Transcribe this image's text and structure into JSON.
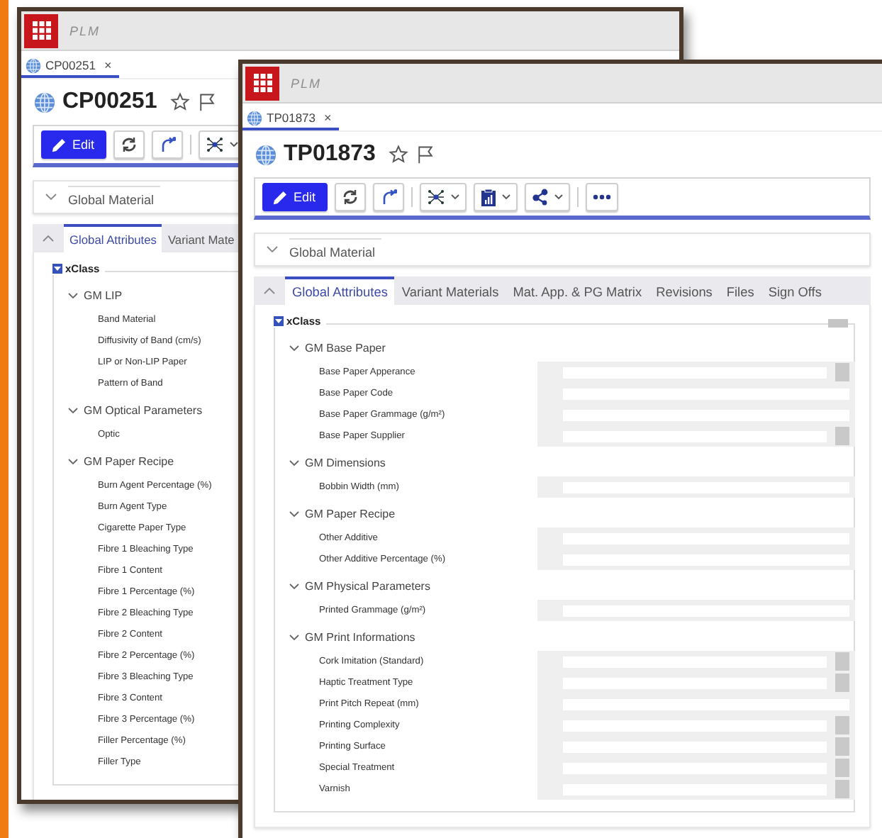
{
  "windows": [
    {
      "logo": "PLM",
      "doc_tab": {
        "label": "CP00251",
        "close": "×",
        "selected": true
      },
      "title": "CP00251",
      "toolbar": [
        {
          "kind": "edit",
          "label": "Edit"
        },
        {
          "kind": "refresh"
        },
        {
          "kind": "redo"
        },
        {
          "kind": "separator"
        },
        {
          "kind": "network",
          "menu": true
        }
      ],
      "section": {
        "label": "Global Material",
        "expanded": false
      },
      "tabs_expanded": true,
      "tabs": [
        {
          "label": "Global Attributes",
          "selected": true
        },
        {
          "label": "Variant Mate",
          "selected": false
        }
      ],
      "panel": {
        "title": "xClass",
        "groups": [
          {
            "name": "GM LIP",
            "expanded": true,
            "attributes": [
              {
                "label": "Band Material"
              },
              {
                "label": "Diffusivity of Band (cm/s)"
              },
              {
                "label": "LIP or Non-LIP Paper"
              },
              {
                "label": "Pattern of Band"
              }
            ]
          },
          {
            "name": "GM Optical Parameters",
            "expanded": true,
            "attributes": [
              {
                "label": "Optic"
              }
            ]
          },
          {
            "name": "GM Paper Recipe",
            "expanded": true,
            "attributes": [
              {
                "label": "Burn Agent Percentage (%)"
              },
              {
                "label": "Burn Agent Type"
              },
              {
                "label": "Cigarette Paper Type"
              },
              {
                "label": "Fibre 1 Bleaching Type"
              },
              {
                "label": "Fibre 1 Content"
              },
              {
                "label": "Fibre 1 Percentage (%)"
              },
              {
                "label": "Fibre 2 Bleaching Type"
              },
              {
                "label": "Fibre 2 Content"
              },
              {
                "label": "Fibre 2 Percentage (%)"
              },
              {
                "label": "Fibre 3 Bleaching Type"
              },
              {
                "label": "Fibre 3 Content"
              },
              {
                "label": "Fibre 3 Percentage (%)"
              },
              {
                "label": "Filler Percentage (%)"
              },
              {
                "label": "Filler Type"
              }
            ]
          }
        ]
      }
    },
    {
      "logo": "PLM",
      "doc_tab": {
        "label": "TP01873",
        "close": "×",
        "selected": true
      },
      "title": "TP01873",
      "toolbar": [
        {
          "kind": "edit",
          "label": "Edit"
        },
        {
          "kind": "refresh"
        },
        {
          "kind": "redo"
        },
        {
          "kind": "separator"
        },
        {
          "kind": "network",
          "menu": true
        },
        {
          "kind": "report",
          "menu": true
        },
        {
          "kind": "share",
          "menu": true
        },
        {
          "kind": "separator"
        },
        {
          "kind": "more"
        }
      ],
      "section": {
        "label": "Global Material",
        "expanded": false
      },
      "tabs_expanded": true,
      "tabs": [
        {
          "label": "Global Attributes",
          "selected": true
        },
        {
          "label": "Variant Materials",
          "selected": false
        },
        {
          "label": "Mat. App. & PG Matrix",
          "selected": false
        },
        {
          "label": "Revisions",
          "selected": false
        },
        {
          "label": "Files",
          "selected": false
        },
        {
          "label": "Sign Offs",
          "selected": false
        }
      ],
      "panel": {
        "title": "xClass",
        "menu": true,
        "groups": [
          {
            "name": "GM Base Paper",
            "expanded": true,
            "attributes": [
              {
                "label": "Base Paper Apperance",
                "kind": "select"
              },
              {
                "label": "Base Paper Code",
                "kind": "text"
              },
              {
                "label": "Base Paper Grammage (g/m²)",
                "kind": "text"
              },
              {
                "label": "Base Paper Supplier",
                "kind": "select"
              }
            ]
          },
          {
            "name": "GM Dimensions",
            "expanded": true,
            "attributes": [
              {
                "label": "Bobbin Width (mm)",
                "kind": "text"
              }
            ]
          },
          {
            "name": "GM Paper Recipe",
            "expanded": true,
            "attributes": [
              {
                "label": "Other Additive",
                "kind": "text"
              },
              {
                "label": "Other Additive Percentage (%)",
                "kind": "text"
              }
            ]
          },
          {
            "name": "GM Physical Parameters",
            "expanded": true,
            "attributes": [
              {
                "label": "Printed Grammage (g/m²)",
                "kind": "text"
              }
            ]
          },
          {
            "name": "GM Print Informations",
            "expanded": true,
            "attributes": [
              {
                "label": "Cork Imitation (Standard)",
                "kind": "select"
              },
              {
                "label": "Haptic Treatment Type",
                "kind": "select"
              },
              {
                "label": "Print Pitch Repeat (mm)",
                "kind": "text"
              },
              {
                "label": "Printing Complexity",
                "kind": "select"
              },
              {
                "label": "Printing Surface",
                "kind": "select"
              },
              {
                "label": "Special Treatment",
                "kind": "select"
              },
              {
                "label": "Varnish",
                "kind": "select"
              }
            ]
          }
        ]
      }
    }
  ]
}
